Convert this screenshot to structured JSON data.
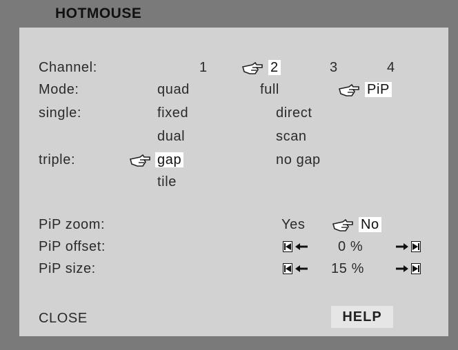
{
  "title": "HOTMOUSE",
  "channel": {
    "label": "Channel:",
    "options": [
      "1",
      "2",
      "3",
      "4"
    ],
    "selected": "2"
  },
  "mode": {
    "label": "Mode:",
    "options": [
      "quad",
      "full",
      "PiP"
    ],
    "selected": "PiP"
  },
  "single": {
    "label": "single:",
    "options": [
      "fixed",
      "direct",
      "dual",
      "scan"
    ]
  },
  "triple": {
    "label": "triple:",
    "options": [
      "gap",
      "no gap",
      "tile"
    ],
    "selected": "gap"
  },
  "pip_zoom": {
    "label": "PiP zoom:",
    "yes": "Yes",
    "no": "No",
    "selected": "No"
  },
  "pip_offset": {
    "label": "PiP offset:",
    "value": "0 %"
  },
  "pip_size": {
    "label": "PiP size:",
    "value": "15 %"
  },
  "buttons": {
    "close": "CLOSE",
    "help": "HELP"
  },
  "icons": {
    "pointer": "hand-pointer-icon",
    "first": "skip-to-start-icon",
    "left": "arrow-left-icon",
    "right": "arrow-right-icon",
    "last": "skip-to-end-icon"
  },
  "colors": {
    "frame": "#7a7a7a",
    "panel": "#d2d2d2",
    "selected_bg": "#ffffff"
  }
}
